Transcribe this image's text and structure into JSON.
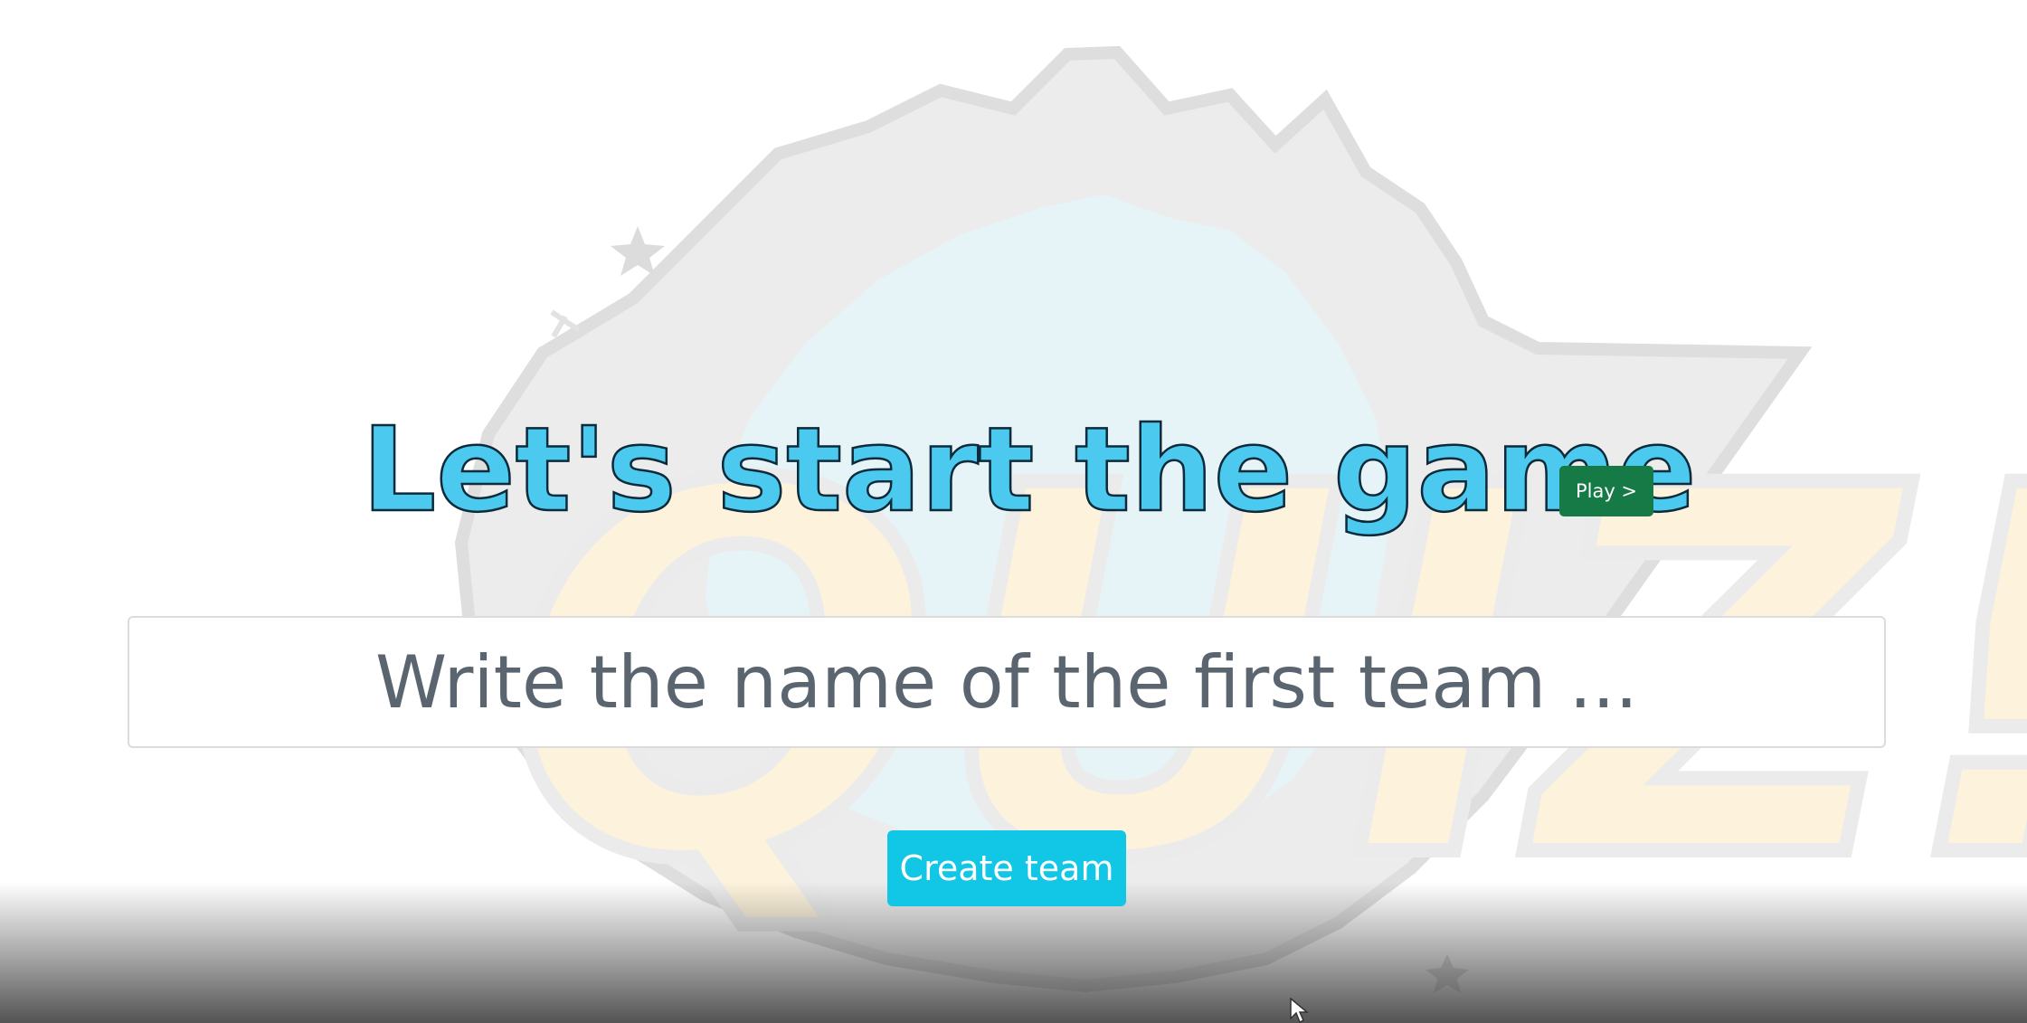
{
  "title": "Let's start the game",
  "play_button": {
    "label": "Play >"
  },
  "team_input": {
    "placeholder": "Write the name of the first team ...",
    "value": ""
  },
  "create_button": {
    "label": "Create team"
  },
  "background": {
    "icon": "quiz-burst-art",
    "word": "QUIZ!"
  },
  "colors": {
    "title": "#4cc9ee",
    "play_button": "#157a45",
    "create_button": "#12c6e6",
    "input_text": "#5a6570"
  }
}
